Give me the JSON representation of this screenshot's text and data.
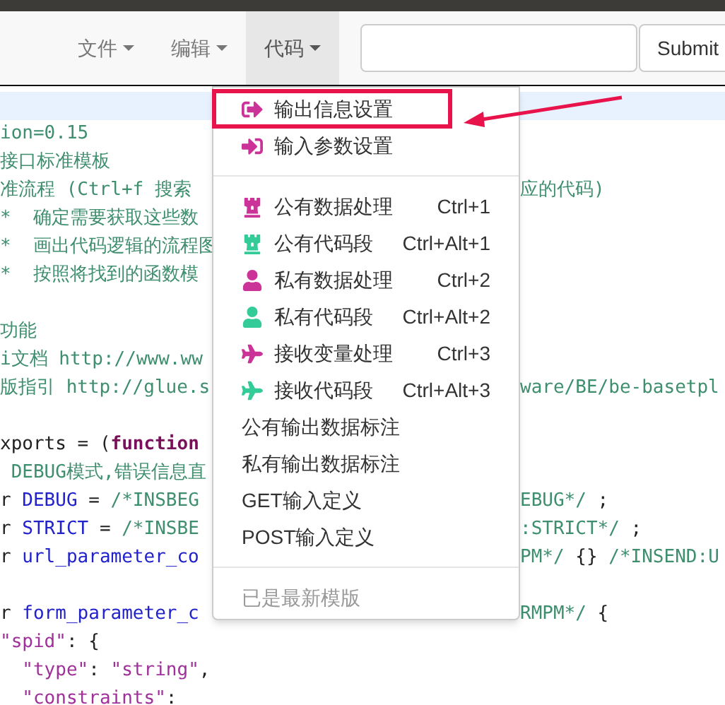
{
  "navbar": {
    "menus": [
      {
        "label": "文件",
        "selected": false
      },
      {
        "label": "编辑",
        "selected": false
      },
      {
        "label": "代码",
        "selected": true
      }
    ],
    "search": {
      "button": "Submit"
    }
  },
  "code_lines": [
    {
      "highlighted": true
    },
    {
      "highlighted": false,
      "left": [
        {
          "kind": "comment",
          "text": "ion=0.15"
        }
      ]
    },
    {
      "highlighted": false,
      "left": [
        {
          "kind": "comment",
          "text": "接口标准模板"
        }
      ]
    },
    {
      "highlighted": false,
      "left": [
        {
          "kind": "comment",
          "text": "准流程 (Ctrl+f 搜索"
        }
      ],
      "right": [
        {
          "kind": "comment",
          "text": "应的代码)"
        }
      ]
    },
    {
      "highlighted": false,
      "left": [
        {
          "kind": "comment",
          "text": "*  确定需要获取这些数"
        }
      ]
    },
    {
      "highlighted": false,
      "left": [
        {
          "kind": "comment",
          "text": "*  画出代码逻辑的流程图"
        }
      ]
    },
    {
      "highlighted": false,
      "left": [
        {
          "kind": "comment",
          "text": "*  按照将找到的函数模"
        }
      ]
    },
    {
      "highlighted": false
    },
    {
      "highlighted": false,
      "left": [
        {
          "kind": "comment",
          "text": "功能"
        }
      ]
    },
    {
      "highlighted": false,
      "left": [
        {
          "kind": "comment",
          "text": "i文档 http://www.ww"
        }
      ]
    },
    {
      "highlighted": false,
      "left": [
        {
          "kind": "comment",
          "text": "版指引 http://glue.s"
        }
      ],
      "right": [
        {
          "kind": "comment",
          "text": "ware/BE/be-basetpl"
        }
      ]
    },
    {
      "highlighted": false
    },
    {
      "highlighted": false,
      "left": [
        {
          "kind": "plain",
          "text": "xports = ("
        },
        {
          "kind": "keyword",
          "text": "function"
        }
      ]
    },
    {
      "highlighted": false,
      "left": [
        {
          "kind": "comment",
          "text": " DEBUG模式,错误信息直"
        }
      ]
    },
    {
      "highlighted": false,
      "left": [
        {
          "kind": "plain",
          "text": "r "
        },
        {
          "kind": "variable",
          "text": "DEBUG"
        },
        {
          "kind": "plain",
          "text": " = "
        },
        {
          "kind": "comment",
          "text": "/*INSBEG"
        }
      ],
      "right": [
        {
          "kind": "comment",
          "text": "EBUG*/"
        },
        {
          "kind": "plain",
          "text": " ;"
        }
      ]
    },
    {
      "highlighted": false,
      "left": [
        {
          "kind": "plain",
          "text": "r "
        },
        {
          "kind": "variable",
          "text": "STRICT"
        },
        {
          "kind": "plain",
          "text": " = "
        },
        {
          "kind": "comment",
          "text": "/*INSBE"
        }
      ],
      "right": [
        {
          "kind": "comment",
          "text": ":STRICT*/"
        },
        {
          "kind": "plain",
          "text": " ;"
        }
      ]
    },
    {
      "highlighted": false,
      "left": [
        {
          "kind": "plain",
          "text": "r "
        },
        {
          "kind": "variable",
          "text": "url_parameter_co"
        }
      ],
      "right": [
        {
          "kind": "comment",
          "text": "PM*/"
        },
        {
          "kind": "plain",
          "text": " {} "
        },
        {
          "kind": "comment",
          "text": "/*INSEND:U"
        }
      ]
    },
    {
      "highlighted": false
    },
    {
      "highlighted": false,
      "left": [
        {
          "kind": "plain",
          "text": "r "
        },
        {
          "kind": "variable",
          "text": "form_parameter_c"
        }
      ],
      "right": [
        {
          "kind": "comment",
          "text": "RMPM*/"
        },
        {
          "kind": "plain",
          "text": " {"
        }
      ]
    },
    {
      "highlighted": false,
      "left": [
        {
          "kind": "string",
          "text": "\"spid\""
        },
        {
          "kind": "plain",
          "text": ": {"
        }
      ]
    },
    {
      "highlighted": false,
      "left": [
        {
          "kind": "string",
          "text": "  \"type\""
        },
        {
          "kind": "plain",
          "text": ": "
        },
        {
          "kind": "string",
          "text": "\"string\""
        },
        {
          "kind": "plain",
          "text": ","
        }
      ]
    },
    {
      "highlighted": false,
      "left": [
        {
          "kind": "string",
          "text": "  \"constraints\""
        },
        {
          "kind": "plain",
          "text": ":"
        }
      ]
    }
  ],
  "dropdown": {
    "sections": [
      [
        {
          "kind": "exit",
          "color": "#cc3399",
          "label": "输出信息设置",
          "annotated": true
        },
        {
          "kind": "enter",
          "color": "#cc3399",
          "label": "输入参数设置",
          "annotated": false
        }
      ],
      [
        {
          "kind": "rook",
          "color": "#cc3399",
          "label": "公有数据处理",
          "shortcut": "Ctrl+1",
          "annotated": false
        },
        {
          "kind": "rook",
          "color": "#33cc99",
          "label": "公有代码段",
          "shortcut": "Ctrl+Alt+1",
          "annotated": false
        },
        {
          "kind": "person",
          "color": "#cc3399",
          "label": "私有数据处理",
          "shortcut": "Ctrl+2",
          "annotated": false
        },
        {
          "kind": "person",
          "color": "#33cc99",
          "label": "私有代码段",
          "shortcut": "Ctrl+Alt+2",
          "annotated": false
        },
        {
          "kind": "plane",
          "color": "#cc3399",
          "label": "接收变量处理",
          "shortcut": "Ctrl+3",
          "annotated": false
        },
        {
          "kind": "plane",
          "color": "#33cc99",
          "label": "接收代码段",
          "shortcut": "Ctrl+Alt+3",
          "annotated": false
        },
        {
          "kind": "text",
          "label": "公有输出数据标注",
          "annotated": false
        },
        {
          "kind": "text",
          "label": "私有输出数据标注",
          "annotated": false
        },
        {
          "kind": "text",
          "label": "GET输入定义",
          "annotated": false
        },
        {
          "kind": "text",
          "label": "POST输入定义",
          "annotated": false
        }
      ],
      [
        {
          "kind": "text",
          "label": "已是最新模版",
          "disabled": true,
          "annotated": false
        }
      ]
    ]
  }
}
